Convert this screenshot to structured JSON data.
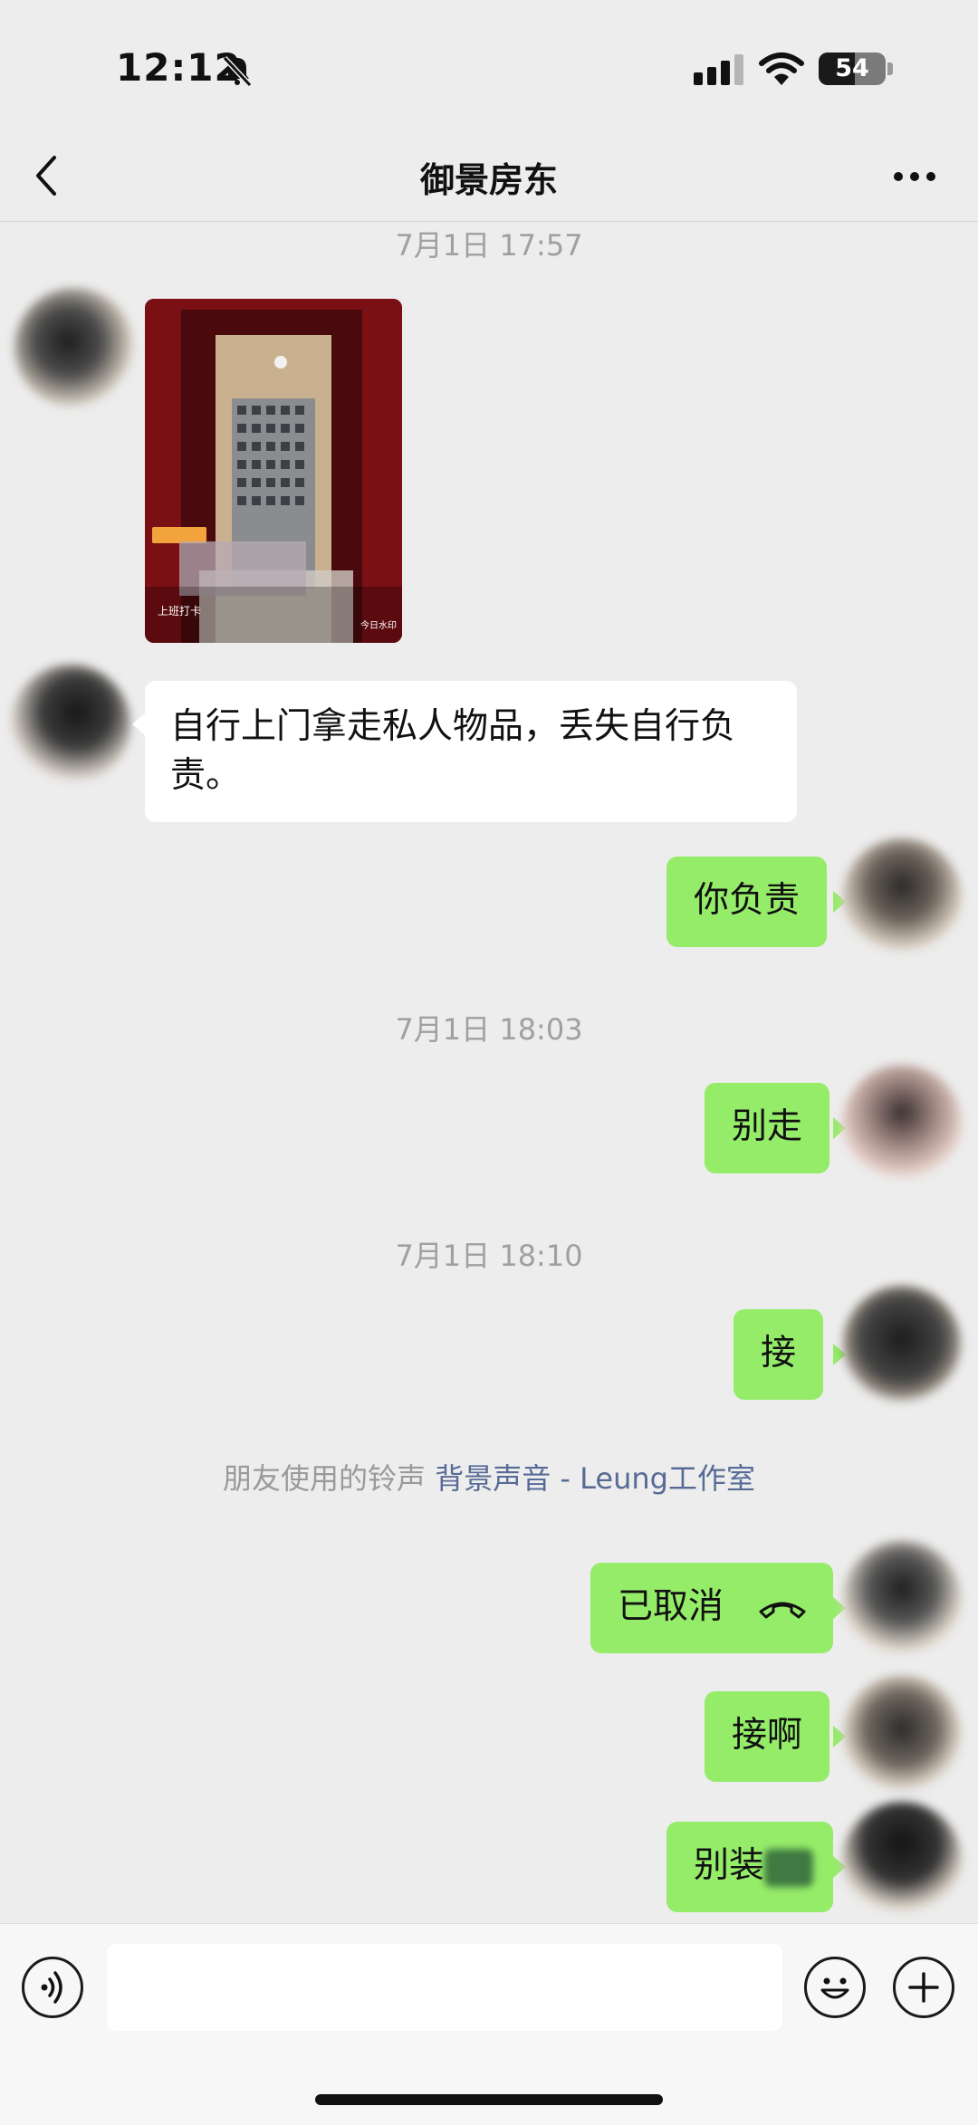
{
  "status_bar": {
    "time": "12:12",
    "battery": "54",
    "battery_level": 0.54
  },
  "header": {
    "title": "御景房东"
  },
  "messages": [
    {
      "type": "timestamp",
      "text": "7月1日 17:57"
    },
    {
      "type": "image",
      "side": "in",
      "watermark_label": "上班打卡",
      "watermark_brand": "今日水印"
    },
    {
      "type": "text",
      "side": "in",
      "text": "自行上门拿走私人物品，丢失自行负责。"
    },
    {
      "type": "text",
      "side": "out",
      "text": "你负责"
    },
    {
      "type": "timestamp",
      "text": "7月1日 18:03"
    },
    {
      "type": "text",
      "side": "out",
      "text": "别走"
    },
    {
      "type": "timestamp",
      "text": "7月1日 18:10"
    },
    {
      "type": "text",
      "side": "out",
      "text": "接"
    },
    {
      "type": "call",
      "side": "out",
      "text": "已取消",
      "icon": "hangup-icon"
    },
    {
      "type": "text",
      "side": "out",
      "text": "接啊"
    },
    {
      "type": "text",
      "side": "out",
      "text": "别装"
    }
  ],
  "ringtone": {
    "prefix": "朋友使用的铃声",
    "song": "背景声音 - Leung工作室"
  },
  "input_bar": {
    "placeholder": ""
  },
  "colors": {
    "background": "#ededed",
    "outgoing_bubble": "#95ec69",
    "incoming_bubble": "#ffffff",
    "link": "#576b95"
  }
}
